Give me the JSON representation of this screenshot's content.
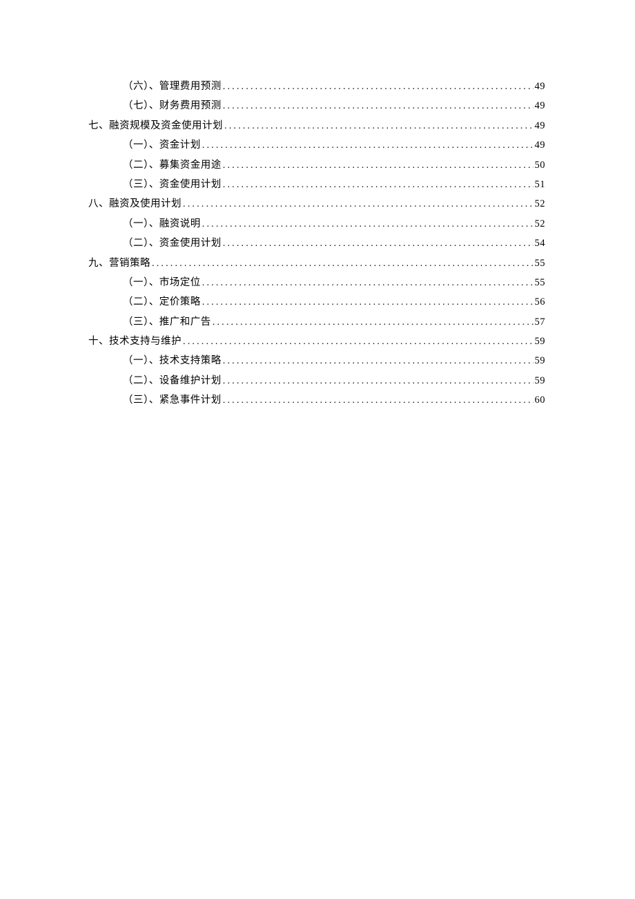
{
  "toc": [
    {
      "level": 2,
      "title": "（六）、管理费用预测",
      "page": "49"
    },
    {
      "level": 2,
      "title": "（七）、财务费用预测",
      "page": "49"
    },
    {
      "level": 1,
      "title": "七、融资规模及资金使用计划",
      "page": "49"
    },
    {
      "level": 2,
      "title": "（一）、资金计划",
      "page": "49"
    },
    {
      "level": 2,
      "title": "（二）、募集资金用途",
      "page": "50"
    },
    {
      "level": 2,
      "title": "（三）、资金使用计划",
      "page": "51"
    },
    {
      "level": 1,
      "title": "八、融资及使用计划",
      "page": "52"
    },
    {
      "level": 2,
      "title": "（一）、融资说明",
      "page": "52"
    },
    {
      "level": 2,
      "title": "（二）、资金使用计划",
      "page": "54"
    },
    {
      "level": 1,
      "title": "九、营销策略",
      "page": "55"
    },
    {
      "level": 2,
      "title": "（一）、市场定位",
      "page": "55"
    },
    {
      "level": 2,
      "title": "（二）、定价策略",
      "page": "56"
    },
    {
      "level": 2,
      "title": "（三）、推广和广告",
      "page": "57"
    },
    {
      "level": 1,
      "title": "十、技术支持与维护",
      "page": "59"
    },
    {
      "level": 2,
      "title": "（一）、技术支持策略",
      "page": "59"
    },
    {
      "level": 2,
      "title": "（二）、设备维护计划",
      "page": "59"
    },
    {
      "level": 2,
      "title": "（三）、紧急事件计划",
      "page": "60"
    }
  ]
}
